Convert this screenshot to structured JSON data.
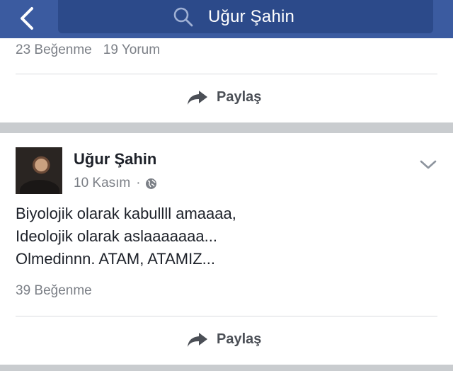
{
  "search": {
    "query": "Uğur Şahin",
    "icon": "search-icon"
  },
  "nav": {
    "back_icon": "chevron-left-icon"
  },
  "posts": [
    {
      "likes": "23 Beğenme",
      "comments": "19 Yorum",
      "share_label": "Paylaş"
    },
    {
      "author": "Uğur Şahin",
      "date": "10 Kasım",
      "separator": "·",
      "privacy_icon": "globe-icon",
      "text_lines": [
        "Biyolojik olarak kabullll amaaaa,",
        "Ideolojik olarak aslaaaaaaa...",
        "Olmedinnn. ATAM, ATAMIZ..."
      ],
      "likes": "39 Beğenme",
      "share_label": "Paylaş"
    }
  ],
  "colors": {
    "header": "#3b5ba0",
    "search_box": "#2c4a8a",
    "muted_text": "#7b7f86"
  }
}
